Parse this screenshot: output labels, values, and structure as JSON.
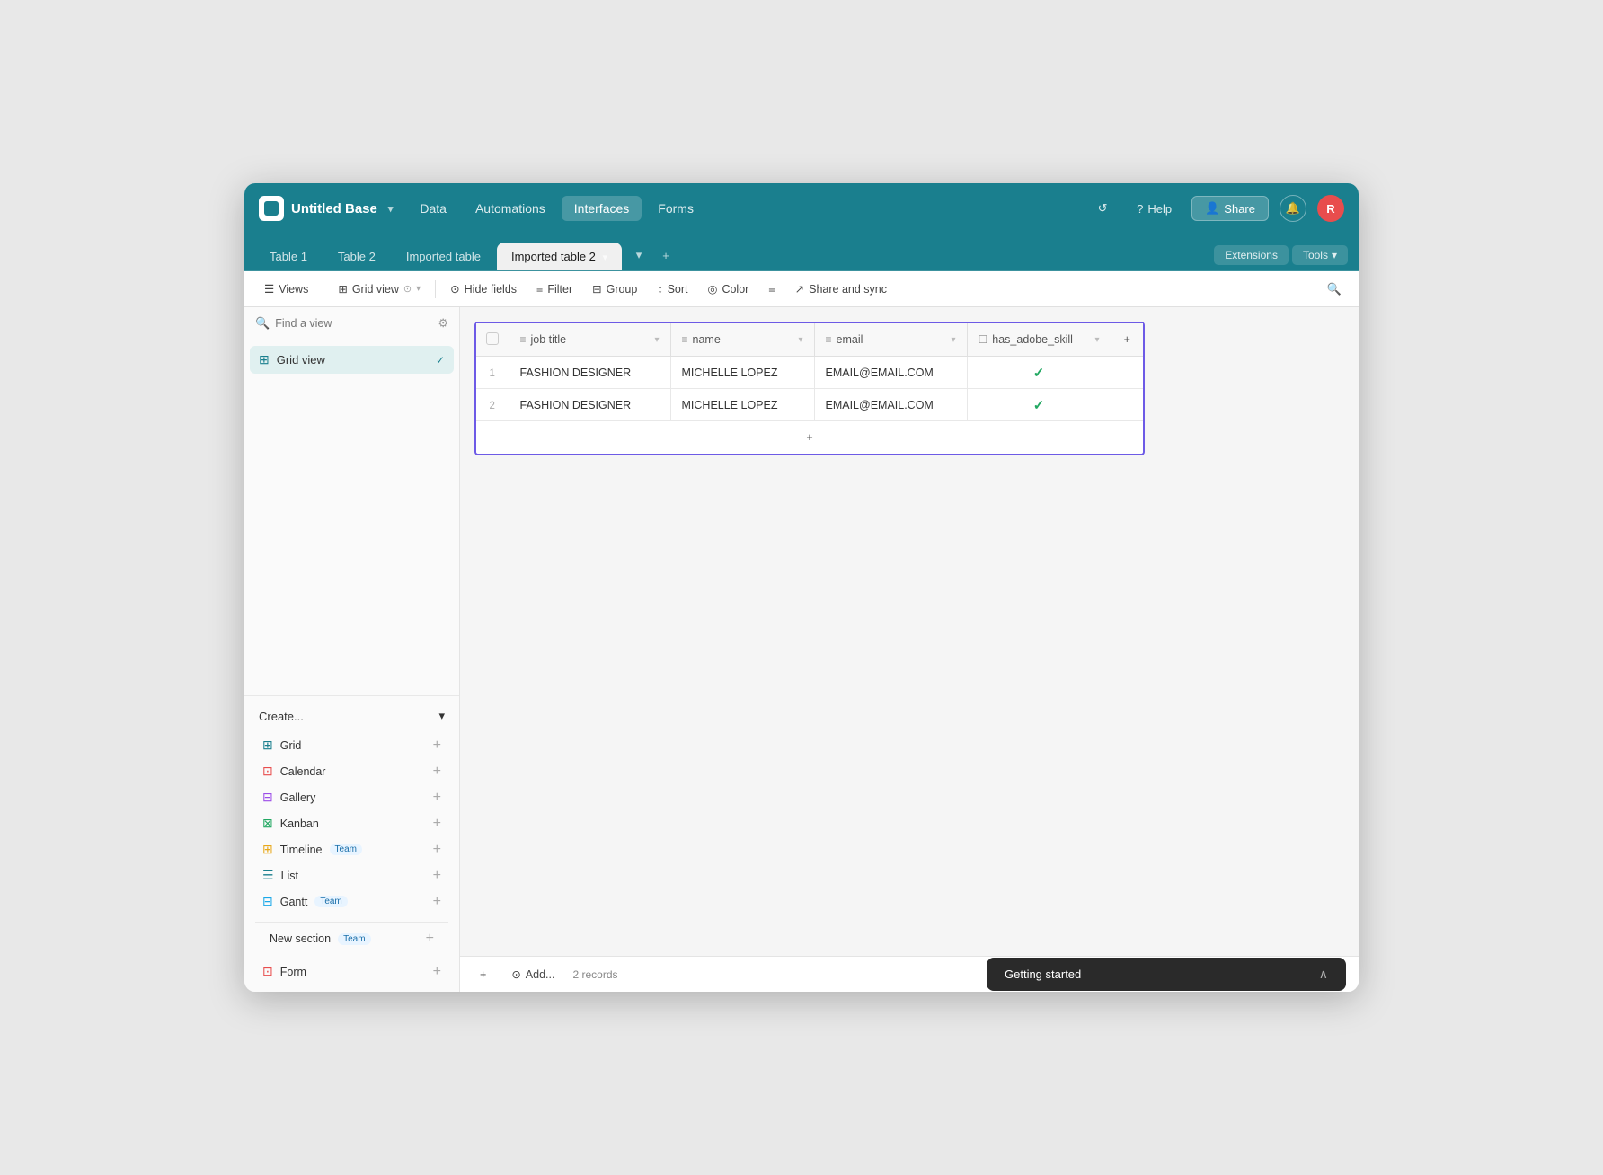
{
  "window": {
    "title": "Untitled Base"
  },
  "topnav": {
    "logo_text": "Untitled Base",
    "nav_items": [
      {
        "label": "Data",
        "active": false
      },
      {
        "label": "Automations",
        "active": false
      },
      {
        "label": "Interfaces",
        "active": true
      },
      {
        "label": "Forms",
        "active": false
      }
    ],
    "history_icon": "↺",
    "help_label": "Help",
    "share_label": "Share",
    "avatar_label": "R"
  },
  "tabs": [
    {
      "label": "Table 1"
    },
    {
      "label": "Table 2"
    },
    {
      "label": "Imported table"
    },
    {
      "label": "Imported table 2",
      "active": true
    }
  ],
  "tab_extras": {
    "caret_icon": "▾",
    "add_icon": "+"
  },
  "tabbar_right": {
    "extensions_label": "Extensions",
    "tools_label": "Tools",
    "tools_caret": "▾"
  },
  "toolbar": {
    "views_label": "Views",
    "gridview_label": "Grid view",
    "hide_fields_label": "Hide fields",
    "filter_label": "Filter",
    "group_label": "Group",
    "sort_label": "Sort",
    "color_label": "Color",
    "row_height_icon": "≡",
    "share_sync_label": "Share and sync"
  },
  "sidebar": {
    "search_placeholder": "Find a view",
    "views": [
      {
        "label": "Grid view",
        "icon": "⊞",
        "active": true
      }
    ],
    "create_label": "Create...",
    "create_items": [
      {
        "label": "Grid",
        "icon": "⊞",
        "color": "#1a7f8e"
      },
      {
        "label": "Calendar",
        "icon": "⊡",
        "color": "#e84d4d"
      },
      {
        "label": "Gallery",
        "icon": "⊟",
        "color": "#9c4de8"
      },
      {
        "label": "Kanban",
        "icon": "⊠",
        "color": "#22a862"
      },
      {
        "label": "Timeline",
        "icon": "⊞",
        "color": "#e8a81a",
        "badge": "Team"
      },
      {
        "label": "List",
        "icon": "☰",
        "color": "#1a7f8e"
      },
      {
        "label": "Gantt",
        "icon": "⊟",
        "color": "#1aa8e8",
        "badge": "Team"
      }
    ],
    "new_section_label": "New section",
    "new_section_badge": "Team",
    "form_label": "Form",
    "form_icon": "⊡"
  },
  "table": {
    "columns": [
      {
        "label": "job title",
        "icon": "≡≡"
      },
      {
        "label": "name",
        "icon": "≡≡"
      },
      {
        "label": "email",
        "icon": "≡≡"
      },
      {
        "label": "has_adobe_skill",
        "icon": "☐"
      }
    ],
    "rows": [
      {
        "num": "1",
        "job_title": "FASHION DESIGNER",
        "name": "MICHELLE LOPEZ",
        "email": "EMAIL@EMAIL.COM",
        "has_adobe_skill": true
      },
      {
        "num": "2",
        "job_title": "FASHION DESIGNER",
        "name": "MICHELLE LOPEZ",
        "email": "EMAIL@EMAIL.COM",
        "has_adobe_skill": true
      }
    ],
    "records_count": "2 records"
  },
  "getting_started": {
    "label": "Getting started",
    "chevron": "∧"
  }
}
